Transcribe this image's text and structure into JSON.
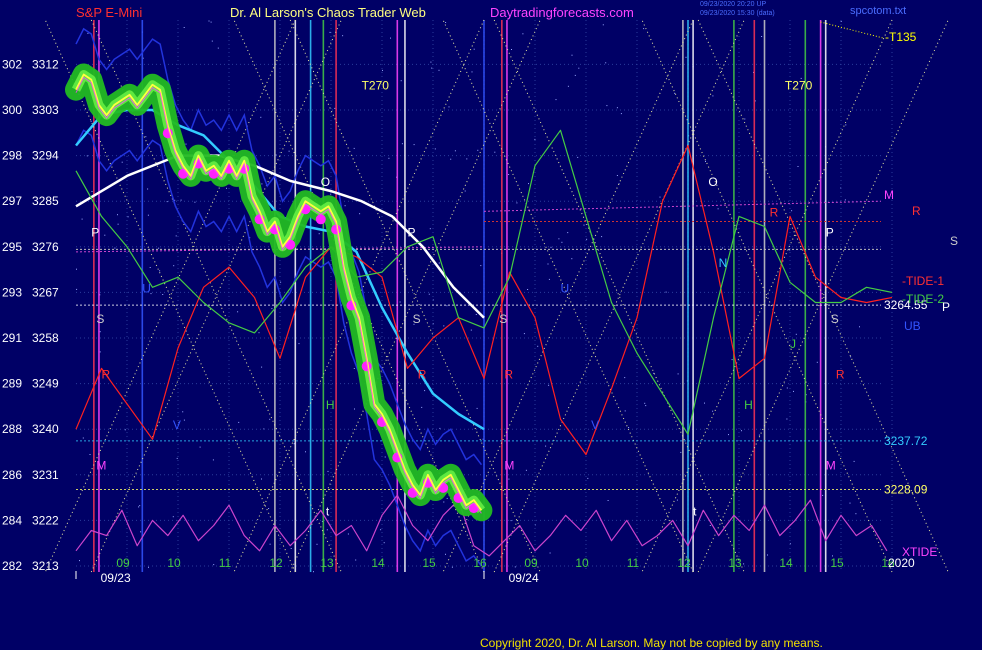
{
  "header": {
    "left": "S&P E-Mini",
    "center": "Dr. Al Larson's Chaos Trader Web",
    "site": "Daytradingforecasts.com",
    "stamp1": "09/23/2020 20:20 UP",
    "stamp2": "09/23/2020 15:30 (data)",
    "file": "spcotom.txt"
  },
  "copyright": "Copyright 2020, Dr. Al Larson. May not be copied by any means.",
  "colors": {
    "background": "#000066",
    "price": "#ffff40",
    "band": "#33cc33",
    "cyan_ma": "#33ccff",
    "white_ma": "#ffffff",
    "tide1": "#ff2020",
    "tide2": "#44cc44",
    "xtide": "#cc44cc",
    "blue_band": "#3344ff",
    "dots": "#ff22ff"
  },
  "chart_data": {
    "type": "line",
    "title": "",
    "xlabel": "",
    "ylabel": "",
    "ylim": [
      3213,
      3318
    ],
    "grid": true,
    "y_ticks": [
      {
        "left": "302",
        "right": "3312",
        "value": 3312
      },
      {
        "left": "300",
        "right": "3303",
        "value": 3303
      },
      {
        "left": "298",
        "right": "3294",
        "value": 3294
      },
      {
        "left": "297",
        "right": "3285",
        "value": 3285
      },
      {
        "left": "295",
        "right": "3276",
        "value": 3276
      },
      {
        "left": "293",
        "right": "3267",
        "value": 3267
      },
      {
        "left": "291",
        "right": "3258",
        "value": 3258
      },
      {
        "left": "289",
        "right": "3249",
        "value": 3249
      },
      {
        "left": "288",
        "right": "3240",
        "value": 3240
      },
      {
        "left": "286",
        "right": "3231",
        "value": 3231
      },
      {
        "left": "284",
        "right": "3222",
        "value": 3222
      },
      {
        "left": "282",
        "right": "3213",
        "value": 3213
      }
    ],
    "x_ticks": [
      {
        "label": "09",
        "t": 1.0
      },
      {
        "label": "10",
        "t": 2.0
      },
      {
        "label": "11",
        "t": 3.0
      },
      {
        "label": "12",
        "t": 4.0
      },
      {
        "label": "13",
        "t": 5.0
      },
      {
        "label": "14",
        "t": 6.0
      },
      {
        "label": "15",
        "t": 7.0
      },
      {
        "label": "16",
        "t": 8.0
      },
      {
        "label": "09",
        "t": 9.0
      },
      {
        "label": "10",
        "t": 10.0
      },
      {
        "label": "11",
        "t": 11.0
      },
      {
        "label": "12",
        "t": 12.0
      },
      {
        "label": "13",
        "t": 13.0
      },
      {
        "label": "14",
        "t": 14.0
      },
      {
        "label": "15",
        "t": 15.0
      },
      {
        "label": "16",
        "t": 16.0
      }
    ],
    "date_labels": [
      {
        "label": "09/23",
        "t": 0.6
      },
      {
        "label": "09/24",
        "t": 8.6
      }
    ],
    "price_series": {
      "name": "",
      "t": [
        0.0,
        0.15,
        0.3,
        0.45,
        0.6,
        0.75,
        0.9,
        1.05,
        1.2,
        1.35,
        1.5,
        1.65,
        1.8,
        1.95,
        2.1,
        2.25,
        2.4,
        2.55,
        2.7,
        2.85,
        3.0,
        3.15,
        3.3,
        3.45,
        3.6,
        3.75,
        3.9,
        4.05,
        4.2,
        4.35,
        4.5,
        4.65,
        4.8,
        4.95,
        5.1,
        5.25,
        5.4,
        5.55,
        5.7,
        5.85,
        6.0,
        6.15,
        6.3,
        6.45,
        6.6,
        6.75,
        6.9,
        7.05,
        7.2,
        7.35,
        7.5,
        7.65,
        7.8,
        7.95
      ],
      "values": [
        3307,
        3310,
        3309,
        3304,
        3302,
        3304,
        3305,
        3306,
        3304,
        3306,
        3308,
        3307,
        3300,
        3295,
        3292,
        3290,
        3294,
        3291,
        3292,
        3290,
        3293,
        3290,
        3293,
        3286,
        3283,
        3279,
        3281,
        3276,
        3278,
        3282,
        3285,
        3284,
        3283,
        3284,
        3281,
        3272,
        3266,
        3262,
        3254,
        3245,
        3243,
        3240,
        3236,
        3232,
        3229,
        3227,
        3231,
        3228,
        3230,
        3231,
        3228,
        3225,
        3226,
        3224
      ]
    },
    "series": [
      {
        "name": "",
        "key": "white_ma",
        "t": [
          0.0,
          1.0,
          2.0,
          2.8,
          3.5,
          4.2,
          5.0,
          5.6,
          6.2,
          6.8,
          7.4,
          8.0
        ],
        "values": [
          3284,
          3290,
          3294,
          3294,
          3292,
          3289,
          3287,
          3285,
          3282,
          3276,
          3268,
          3262
        ]
      },
      {
        "name": "",
        "key": "cyan_ma",
        "t": [
          0.0,
          0.5,
          1.0,
          1.5,
          2.0,
          2.5,
          3.0,
          3.5,
          4.0,
          4.5,
          5.0,
          5.5,
          6.0,
          6.5,
          7.0,
          7.5,
          8.0
        ],
        "values": [
          3296,
          3302,
          3303,
          3303,
          3300,
          3298,
          3293,
          3288,
          3282,
          3280,
          3279,
          3275,
          3264,
          3255,
          3247,
          3243,
          3240
        ]
      },
      {
        "name": "TIDE-1",
        "key": "tide1",
        "t": [
          0.0,
          0.5,
          1.0,
          1.5,
          2.0,
          2.5,
          3.0,
          3.5,
          4.0,
          4.5,
          5.0,
          5.5,
          6.0,
          6.5,
          7.0,
          7.5,
          8.0,
          8.5,
          9.0,
          9.5,
          10.0,
          10.5,
          11.0,
          11.5,
          12.0,
          12.5,
          13.0,
          13.5,
          14.0,
          14.5,
          15.0,
          15.5,
          16.0
        ],
        "values": [
          3240,
          3252,
          3245,
          3238,
          3256,
          3268,
          3272,
          3266,
          3254,
          3270,
          3276,
          3274,
          3270,
          3252,
          3258,
          3262,
          3250,
          3271,
          3262,
          3242,
          3235,
          3248,
          3262,
          3285,
          3296,
          3275,
          3250,
          3254,
          3282,
          3270,
          3266,
          3265,
          3266
        ]
      },
      {
        "name": "TIDE-2",
        "key": "tide2",
        "t": [
          0.0,
          0.5,
          1.0,
          1.5,
          2.0,
          2.5,
          3.0,
          3.5,
          4.0,
          4.5,
          5.0,
          5.5,
          6.0,
          6.5,
          7.0,
          7.5,
          8.0,
          8.5,
          9.0,
          9.5,
          10.0,
          10.5,
          11.0,
          11.5,
          12.0,
          12.5,
          13.0,
          13.5,
          14.0,
          14.5,
          15.0,
          15.5,
          16.0
        ],
        "values": [
          3291,
          3282,
          3276,
          3268,
          3270,
          3265,
          3261,
          3259,
          3265,
          3272,
          3276,
          3270,
          3271,
          3276,
          3278,
          3262,
          3260,
          3270,
          3292,
          3299,
          3282,
          3265,
          3255,
          3247,
          3239,
          3262,
          3282,
          3280,
          3269,
          3265,
          3265,
          3268,
          3267
        ]
      },
      {
        "name": "XTIDE",
        "key": "xtide",
        "t": [
          0.0,
          0.3,
          0.6,
          0.9,
          1.2,
          1.5,
          1.8,
          2.1,
          2.4,
          2.7,
          3.0,
          3.3,
          3.6,
          3.9,
          4.2,
          4.5,
          4.8,
          5.1,
          5.4,
          5.7,
          6.0,
          6.3,
          6.6,
          6.9,
          7.2,
          7.5,
          7.8,
          8.1,
          8.4,
          8.7,
          9.0,
          9.3,
          9.6,
          9.9,
          10.2,
          10.5,
          10.8,
          11.1,
          11.4,
          11.7,
          12.0,
          12.3,
          12.6,
          12.9,
          13.2,
          13.5,
          13.8,
          14.1,
          14.4,
          14.7,
          15.0,
          15.3,
          15.6,
          15.9
        ],
        "values": [
          3216,
          3220,
          3219,
          3224,
          3217,
          3222,
          3219,
          3223,
          3218,
          3221,
          3225,
          3219,
          3216,
          3221,
          3217,
          3220,
          3224,
          3219,
          3221,
          3216,
          3223,
          3227,
          3221,
          3218,
          3223,
          3226,
          3217,
          3215,
          3218,
          3221,
          3216,
          3219,
          3223,
          3220,
          3224,
          3218,
          3222,
          3217,
          3219,
          3222,
          3217,
          3224,
          3219,
          3223,
          3220,
          3225,
          3219,
          3222,
          3226,
          3218,
          3223,
          3219,
          3221,
          3216
        ]
      }
    ],
    "h_levels": [
      {
        "label": "3264.55",
        "value": 3264.5,
        "color": "#ffffff"
      },
      {
        "label": "3237.72",
        "value": 3237.7,
        "color": "#33ccff"
      },
      {
        "label": "3228.09",
        "value": 3228.1,
        "color": "#ffff66"
      }
    ],
    "series_labels": [
      {
        "label": "-T135",
        "color": "#ffff00"
      },
      {
        "label": "M",
        "color": "#ff44ff"
      },
      {
        "label": "R",
        "color": "#ff3030"
      },
      {
        "label": "S",
        "color": "#cccccc"
      },
      {
        "label": "-TIDE-1",
        "color": "#ff3030"
      },
      {
        "label": "-TIDE-2",
        "color": "#44cc44"
      },
      {
        "label": "P",
        "color": "#ffffff"
      },
      {
        "label": "UB",
        "color": "#3355ff"
      },
      {
        "label": "XTIDE",
        "color": "#ff44ff"
      },
      {
        "label": "2020",
        "color": "#ffffff"
      }
    ],
    "annotations": [
      {
        "label": "T270",
        "t": 5.6,
        "value": 3307,
        "color": "#ffff66"
      },
      {
        "label": "T270",
        "t": 13.9,
        "value": 3307,
        "color": "#ffff66"
      },
      {
        "label": "O",
        "t": 4.8,
        "value": 3288,
        "color": "#ffffff"
      },
      {
        "label": "O",
        "t": 12.4,
        "value": 3288,
        "color": "#ffffff"
      },
      {
        "label": "N",
        "t": 12.6,
        "value": 3272,
        "color": "#33ccff"
      },
      {
        "label": "P",
        "t": 0.3,
        "value": 3278,
        "color": "#ffffff"
      },
      {
        "label": "P",
        "t": 6.5,
        "value": 3278,
        "color": "#ffffff"
      },
      {
        "label": "P",
        "t": 14.7,
        "value": 3278,
        "color": "#ffffff"
      },
      {
        "label": "S",
        "t": 0.4,
        "value": 3261,
        "color": "#cccccc"
      },
      {
        "label": "S",
        "t": 6.6,
        "value": 3261,
        "color": "#cccccc"
      },
      {
        "label": "S",
        "t": 8.3,
        "value": 3261,
        "color": "#cccccc"
      },
      {
        "label": "S",
        "t": 14.8,
        "value": 3261,
        "color": "#cccccc"
      },
      {
        "label": "R",
        "t": 0.5,
        "value": 3250,
        "color": "#ff3030"
      },
      {
        "label": "R",
        "t": 6.7,
        "value": 3250,
        "color": "#ff3030"
      },
      {
        "label": "R",
        "t": 8.4,
        "value": 3250,
        "color": "#ff3030"
      },
      {
        "label": "R",
        "t": 14.9,
        "value": 3250,
        "color": "#ff3030"
      },
      {
        "label": "R",
        "t": 13.6,
        "value": 3282,
        "color": "#ff3030"
      },
      {
        "label": "U",
        "t": 1.3,
        "value": 3267,
        "color": "#3355ff"
      },
      {
        "label": "U",
        "t": 9.5,
        "value": 3267,
        "color": "#3355ff"
      },
      {
        "label": "V",
        "t": 1.9,
        "value": 3240,
        "color": "#3355ff"
      },
      {
        "label": "V",
        "t": 10.1,
        "value": 3240,
        "color": "#3355ff"
      },
      {
        "label": "H",
        "t": 4.9,
        "value": 3244,
        "color": "#44cc44"
      },
      {
        "label": "H",
        "t": 13.1,
        "value": 3244,
        "color": "#44cc44"
      },
      {
        "label": "J",
        "t": 14.0,
        "value": 3256,
        "color": "#44cc44"
      },
      {
        "label": "M",
        "t": 0.4,
        "value": 3232,
        "color": "#ff44ff"
      },
      {
        "label": "M",
        "t": 8.4,
        "value": 3232,
        "color": "#ff44ff"
      },
      {
        "label": "M",
        "t": 14.7,
        "value": 3232,
        "color": "#ff44ff"
      },
      {
        "label": "t",
        "t": 4.9,
        "value": 3223,
        "color": "#ffffff"
      },
      {
        "label": "t",
        "t": 12.1,
        "value": 3223,
        "color": "#ffffff"
      }
    ]
  }
}
